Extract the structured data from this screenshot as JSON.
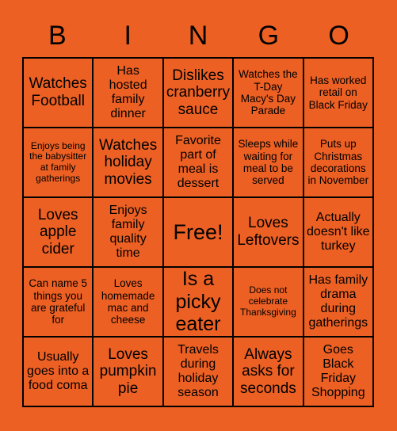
{
  "card": {
    "background_color": "#ED6024",
    "text_color": "#000000",
    "border_color": "#000000",
    "header": {
      "letters": [
        "B",
        "I",
        "N",
        "G",
        "O"
      ]
    },
    "grid": {
      "columns": 5,
      "rows": 5,
      "cells": [
        {
          "text": "Watches Football",
          "size": "lg"
        },
        {
          "text": "Has hosted family dinner",
          "size": "md"
        },
        {
          "text": "Dislikes cranberry sauce",
          "size": "lg"
        },
        {
          "text": "Watches the T-Day Macy's Day Parade",
          "size": "sm"
        },
        {
          "text": "Has worked retail on Black Friday",
          "size": "sm"
        },
        {
          "text": "Enjoys being the babysitter at family gatherings",
          "size": "xs"
        },
        {
          "text": "Watches holiday movies",
          "size": "lg"
        },
        {
          "text": "Favorite part of meal is dessert",
          "size": "md"
        },
        {
          "text": "Sleeps while waiting for meal to be served",
          "size": "sm"
        },
        {
          "text": "Puts up Christmas decorations in November",
          "size": "sm"
        },
        {
          "text": "Loves apple cider",
          "size": "lg"
        },
        {
          "text": "Enjoys family quality time",
          "size": "md"
        },
        {
          "text": "Free!",
          "size": "free"
        },
        {
          "text": "Loves Leftovers",
          "size": "lg"
        },
        {
          "text": "Actually doesn't like turkey",
          "size": "md"
        },
        {
          "text": "Can name 5 things you are grateful for",
          "size": "sm"
        },
        {
          "text": "Loves homemade mac and cheese",
          "size": "sm"
        },
        {
          "text": "Is a picky eater",
          "size": "xl"
        },
        {
          "text": "Does not celebrate Thanksgiving",
          "size": "xs"
        },
        {
          "text": "Has family drama during gatherings",
          "size": "md"
        },
        {
          "text": "Usually goes into a food coma",
          "size": "md"
        },
        {
          "text": "Loves pumpkin pie",
          "size": "lg"
        },
        {
          "text": "Travels during holiday season",
          "size": "md"
        },
        {
          "text": "Always asks for seconds",
          "size": "lg"
        },
        {
          "text": "Goes Black Friday Shopping",
          "size": "md"
        }
      ]
    }
  }
}
